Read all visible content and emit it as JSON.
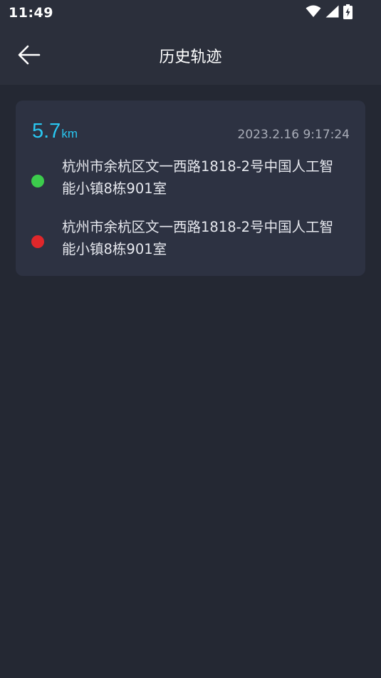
{
  "status_bar": {
    "time": "11:49",
    "icons": [
      "wifi-icon",
      "cellular-signal-icon",
      "battery-charging-icon"
    ]
  },
  "header": {
    "back_icon": "arrow-left-icon",
    "title": "历史轨迹"
  },
  "trip": {
    "distance_value": "5.7",
    "distance_unit": "km",
    "timestamp": "2023.2.16 9:17:24",
    "start": {
      "address": "杭州市余杭区文一西路1818-2号中国人工智能小镇8栋901室",
      "color": "#3ccc4c"
    },
    "end": {
      "address": "杭州市余杭区文一西路1818-2号中国人工智能小镇8栋901室",
      "color": "#e0272b"
    }
  },
  "colors": {
    "background": "#242833",
    "header_background": "#2b2f3b",
    "card_background": "#2d3242",
    "accent": "#29c8f2"
  }
}
